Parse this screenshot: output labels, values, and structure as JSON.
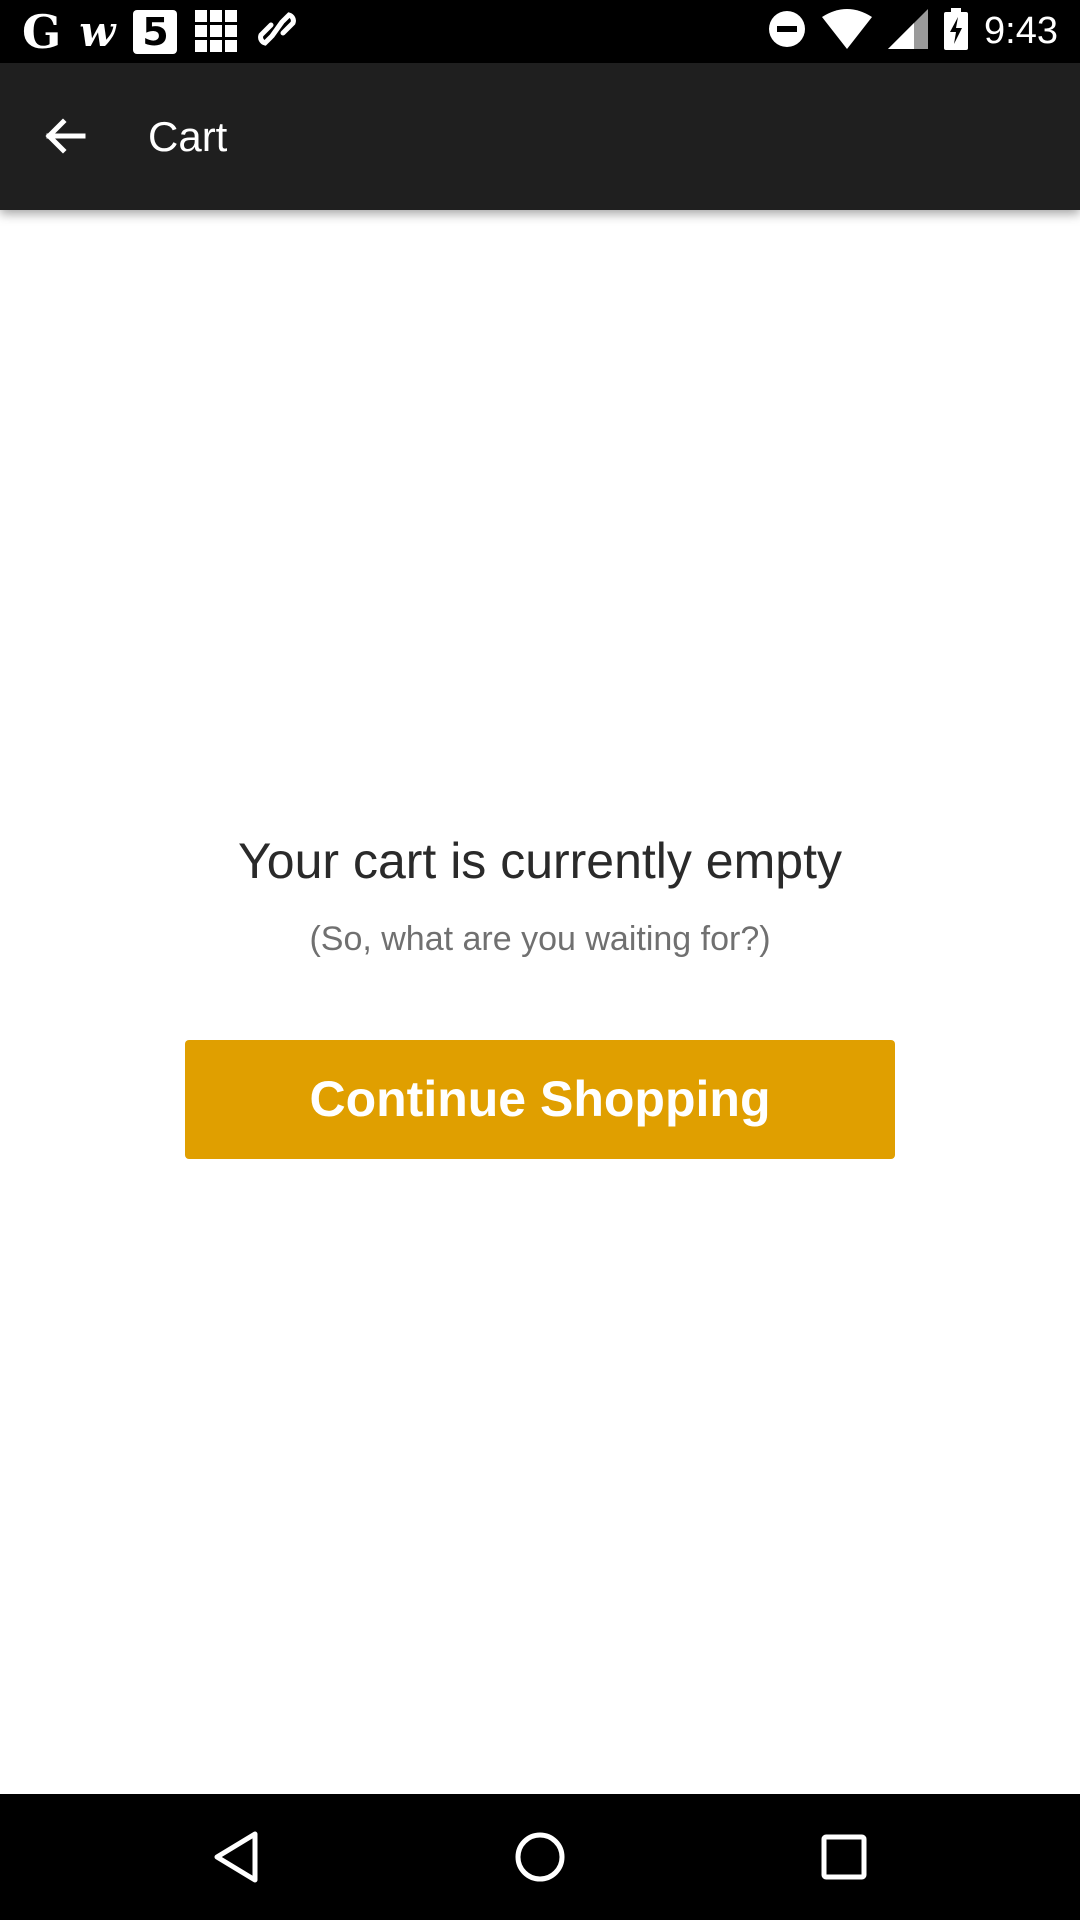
{
  "status_bar": {
    "time": "9:43",
    "notifications": {
      "g_label": "G",
      "w_label": "w",
      "five_label": "5"
    },
    "icons": [
      "g-app-icon",
      "w-app-icon",
      "five-app-icon",
      "grid-app-icon",
      "link-icon",
      "do-not-disturb-icon",
      "wifi-icon",
      "cell-signal-icon",
      "battery-charging-icon"
    ]
  },
  "app_bar": {
    "title": "Cart",
    "background": "#1f1f1f"
  },
  "empty_state": {
    "title": "Your cart is currently empty",
    "subtitle": "(So, what are you waiting for?)",
    "button_label": "Continue Shopping",
    "button_color": "#e09f00"
  },
  "nav_bar": {
    "icons": [
      "nav-back-icon",
      "nav-home-icon",
      "nav-recents-icon"
    ]
  }
}
